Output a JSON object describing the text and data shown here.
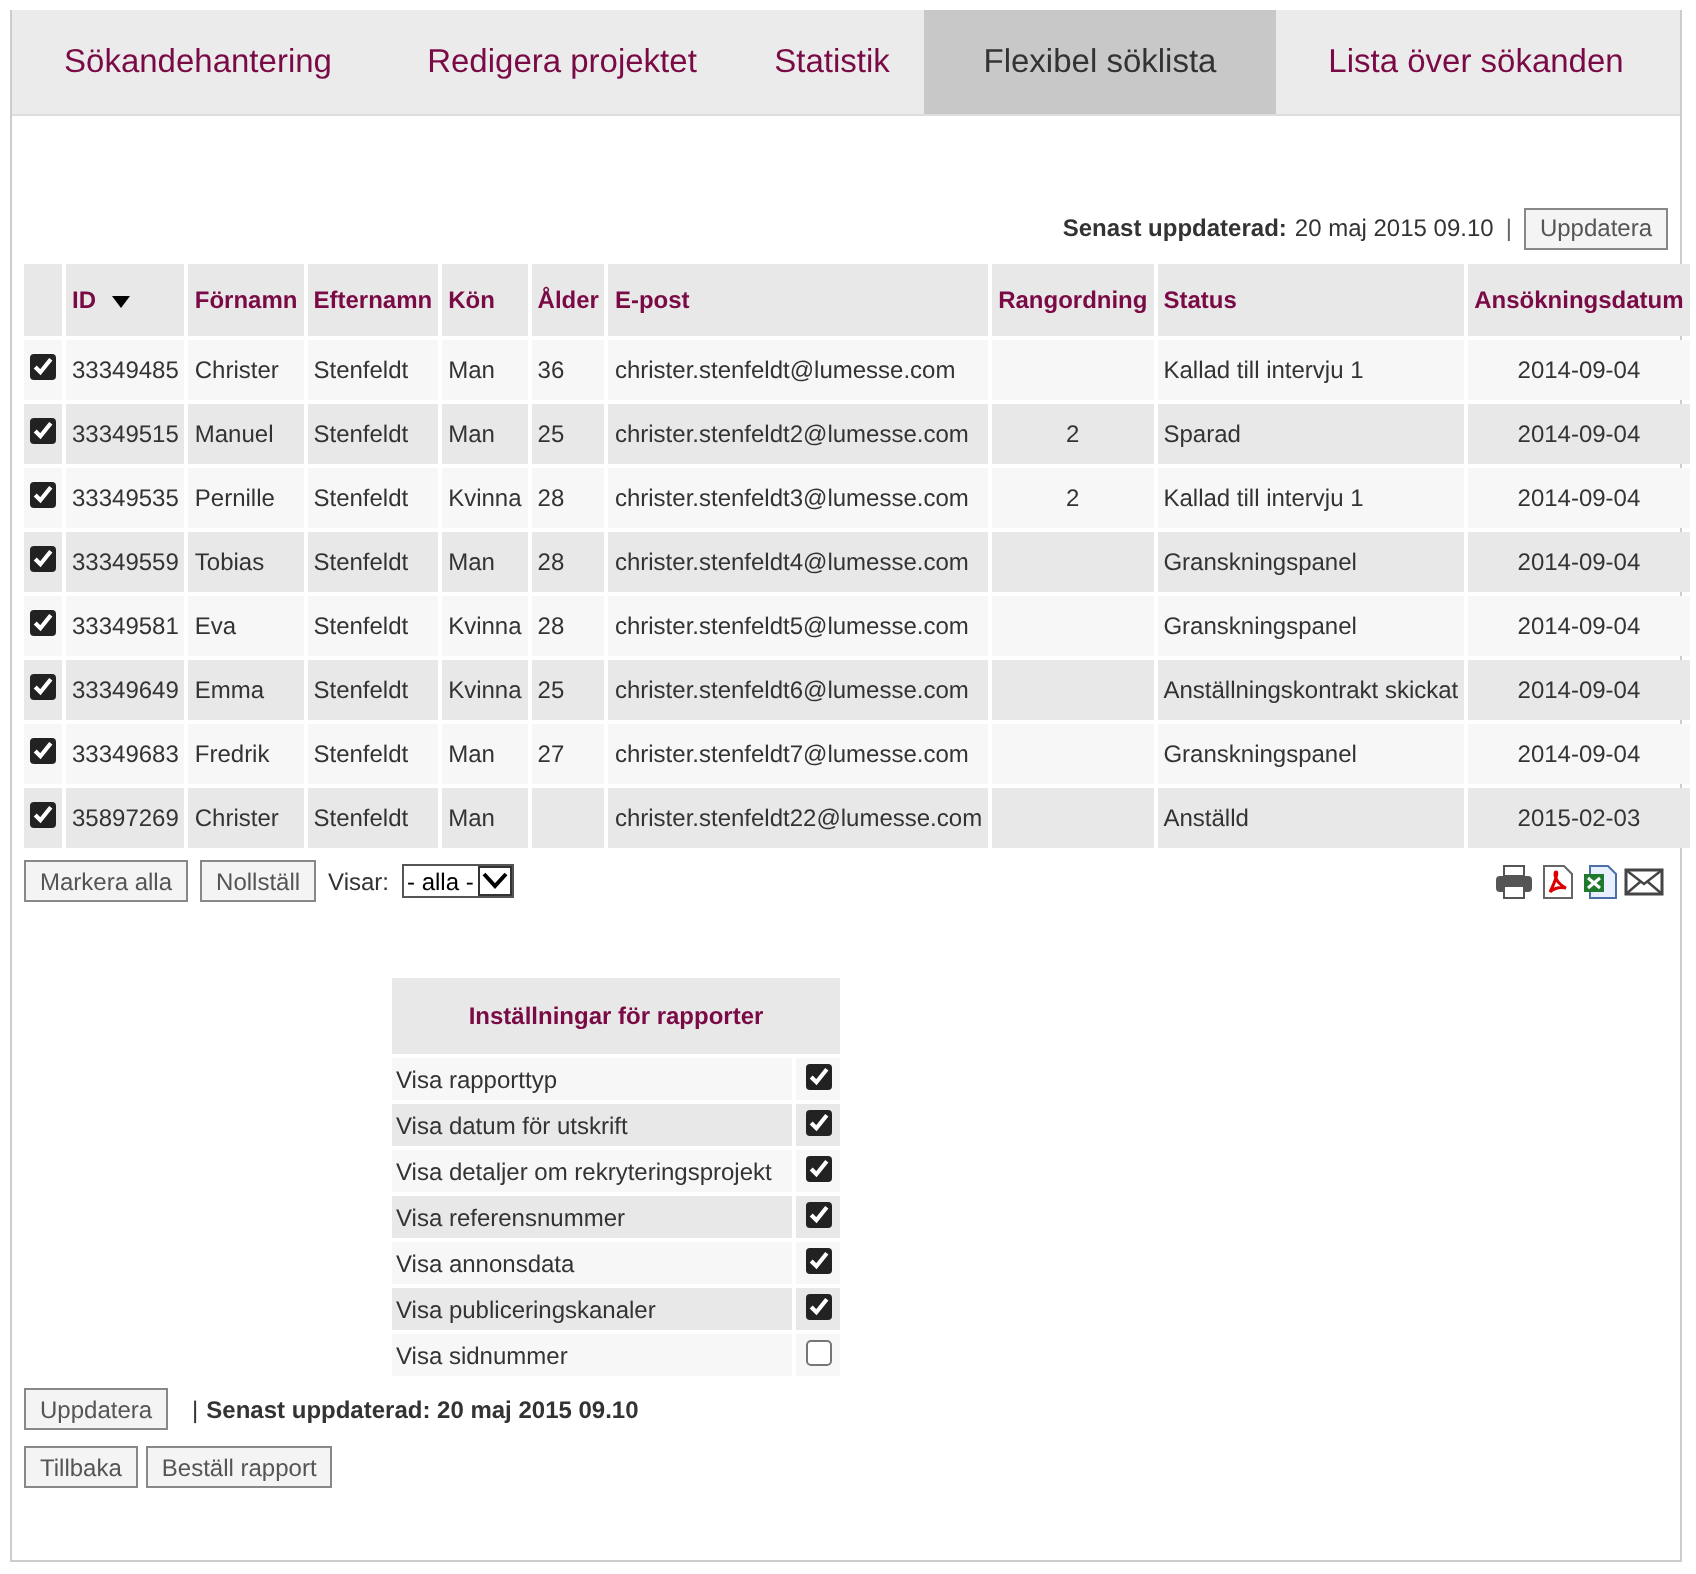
{
  "tabs": [
    {
      "label": "Sökandehantering",
      "selected": false
    },
    {
      "label": "Redigera projektet",
      "selected": false
    },
    {
      "label": "Statistik",
      "selected": false
    },
    {
      "label": "Flexibel söklista",
      "selected": true
    },
    {
      "label": "Lista över sökanden",
      "selected": false
    }
  ],
  "update_bar": {
    "label": "Senast uppdaterad:",
    "value": "20 maj 2015 09.10",
    "separator": "|",
    "button": "Uppdatera"
  },
  "table": {
    "columns": [
      {
        "label": "ID",
        "sorted": true
      },
      {
        "label": "Förnamn",
        "sorted": false
      },
      {
        "label": "Efternamn",
        "sorted": false
      },
      {
        "label": "Kön",
        "sorted": false
      },
      {
        "label": "Ålder",
        "sorted": false
      },
      {
        "label": "E-post",
        "sorted": false
      },
      {
        "label": "Rangordning",
        "sorted": false
      },
      {
        "label": "Status",
        "sorted": false
      },
      {
        "label": "Ansökningsdatum",
        "sorted": false
      }
    ],
    "rows": [
      {
        "checked": true,
        "cells": [
          "33349485",
          "Christer",
          "Stenfeldt",
          "Man",
          "36",
          "christer.stenfeldt@lumesse.com",
          "",
          "Kallad till intervju 1",
          "2014-09-04"
        ]
      },
      {
        "checked": true,
        "cells": [
          "33349515",
          "Manuel",
          "Stenfeldt",
          "Man",
          "25",
          "christer.stenfeldt2@lumesse.com",
          "2",
          "Sparad",
          "2014-09-04"
        ]
      },
      {
        "checked": true,
        "cells": [
          "33349535",
          "Pernille",
          "Stenfeldt",
          "Kvinna",
          "28",
          "christer.stenfeldt3@lumesse.com",
          "2",
          "Kallad till intervju 1",
          "2014-09-04"
        ]
      },
      {
        "checked": true,
        "cells": [
          "33349559",
          "Tobias",
          "Stenfeldt",
          "Man",
          "28",
          "christer.stenfeldt4@lumesse.com",
          "",
          "Granskningspanel",
          "2014-09-04"
        ]
      },
      {
        "checked": true,
        "cells": [
          "33349581",
          "Eva",
          "Stenfeldt",
          "Kvinna",
          "28",
          "christer.stenfeldt5@lumesse.com",
          "",
          "Granskningspanel",
          "2014-09-04"
        ]
      },
      {
        "checked": true,
        "cells": [
          "33349649",
          "Emma",
          "Stenfeldt",
          "Kvinna",
          "25",
          "christer.stenfeldt6@lumesse.com",
          "",
          "Anställningskontrakt skickat",
          "2014-09-04"
        ]
      },
      {
        "checked": true,
        "cells": [
          "33349683",
          "Fredrik",
          "Stenfeldt",
          "Man",
          "27",
          "christer.stenfeldt7@lumesse.com",
          "",
          "Granskningspanel",
          "2014-09-04"
        ]
      },
      {
        "checked": true,
        "cells": [
          "35897269",
          "Christer",
          "Stenfeldt",
          "Man",
          "",
          "christer.stenfeldt22@lumesse.com",
          "",
          "Anställd",
          "2015-02-03"
        ]
      }
    ]
  },
  "table_actions": {
    "buttons": [
      "Markera alla",
      "Nollställ"
    ],
    "filter_label": "Visar:",
    "filter_value": "- alla -"
  },
  "report_settings": {
    "title": "Inställningar för rapporter",
    "items": [
      {
        "label": "Visa rapporttyp",
        "checked": true
      },
      {
        "label": "Visa datum för utskrift",
        "checked": true
      },
      {
        "label": "Visa detaljer om rekryteringsprojekt",
        "checked": true
      },
      {
        "label": "Visa referensnummer",
        "checked": true
      },
      {
        "label": "Visa annonsdata",
        "checked": true
      },
      {
        "label": "Visa publiceringskanaler",
        "checked": true
      },
      {
        "label": "Visa sidnummer",
        "checked": false
      }
    ]
  },
  "bottom": {
    "update_button": "Uppdatera",
    "separator": "|",
    "last_updated": "Senast uppdaterad: 20 maj 2015 09.10",
    "buttons": [
      "Tillbaka",
      "Beställ rapport"
    ]
  }
}
